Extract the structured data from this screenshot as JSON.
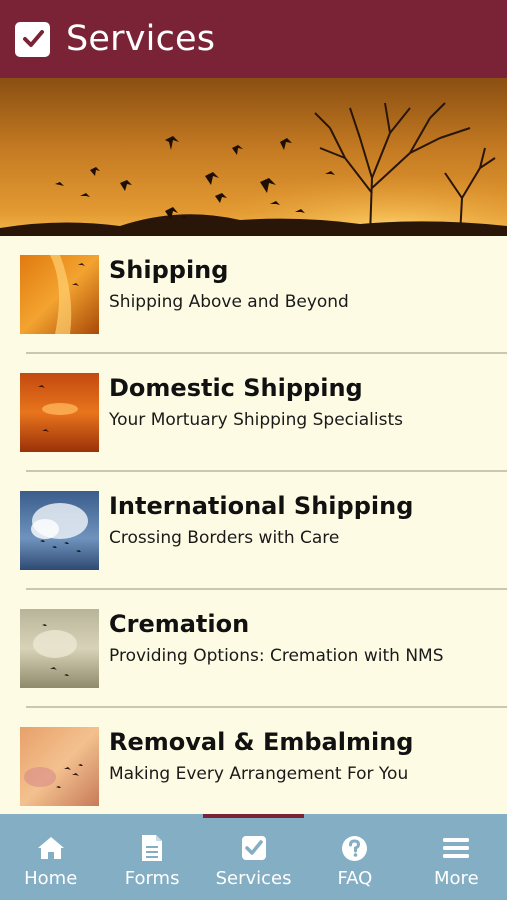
{
  "header": {
    "title": "Services",
    "icon": "checkbox-icon",
    "background": "#7b2336"
  },
  "hero": {
    "description_icon": "sunset-geese-image"
  },
  "services": [
    {
      "title": "Shipping",
      "subtitle": "Shipping Above and Beyond",
      "thumb": "orange-flames-geese"
    },
    {
      "title": "Domestic Shipping",
      "subtitle": "Your Mortuary Shipping Specialists",
      "thumb": "orange-sunset-geese"
    },
    {
      "title": "International Shipping",
      "subtitle": "Crossing Borders with Care",
      "thumb": "blue-sky-clouds-geese"
    },
    {
      "title": "Cremation",
      "subtitle": "Providing Options: Cremation with NMS",
      "thumb": "pale-sky-geese"
    },
    {
      "title": "Removal & Embalming",
      "subtitle": "Making Every Arrangement For You",
      "thumb": "pink-sky-geese"
    }
  ],
  "tabs": [
    {
      "label": "Home",
      "icon": "home-icon"
    },
    {
      "label": "Forms",
      "icon": "document-icon"
    },
    {
      "label": "Services",
      "icon": "checkbox-icon",
      "active": true
    },
    {
      "label": "FAQ",
      "icon": "question-icon"
    },
    {
      "label": "More",
      "icon": "menu-icon"
    }
  ],
  "colors": {
    "accent": "#7b2336",
    "tabbar": "#84aec3",
    "list_bg": "#fefbe4"
  }
}
